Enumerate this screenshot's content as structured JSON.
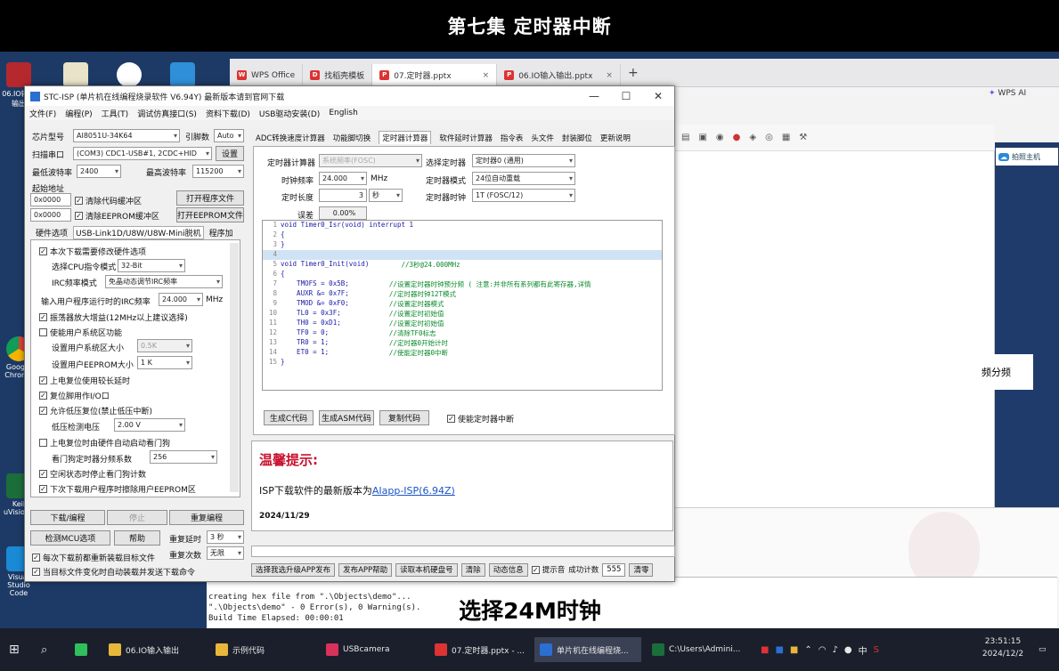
{
  "video_title": "第七集 定时器中断",
  "subtitle": "选择24M时钟",
  "desktop_icons": [
    {
      "label": "06.IO输入输出"
    },
    {
      "label": ""
    },
    {
      "label": ""
    },
    {
      "label": ""
    },
    {
      "label": "Google Chrome"
    },
    {
      "label": "Keil uVision5"
    },
    {
      "label": "Visual Studio Code"
    }
  ],
  "wps": {
    "tabs": [
      {
        "label": "WPS Office",
        "color": "#d33"
      },
      {
        "label": "找稻壳模板",
        "color": "#d33"
      },
      {
        "label": "07.定时器.pptx",
        "color": "#d33"
      },
      {
        "label": "06.IO输入输出.pptx",
        "color": "#d33"
      }
    ],
    "wps_ai": "WPS AI",
    "side_label": "拍照主机",
    "right_text": "频分频",
    "build_output": [
      "creating hex file from \".\\Objects\\demo\"...",
      "\".\\Objects\\demo\" - 0 Error(s), 0 Warning(s).",
      "Build Time Elapsed:  00:00:01"
    ]
  },
  "isp": {
    "title": "STC-ISP (单片机在线编程烧录软件 V6.94Y) 最新版本请到官网下载",
    "menu": [
      "文件(F)",
      "编程(P)",
      "工具(T)",
      "调试仿真接口(S)",
      "资料下载(D)",
      "USB驱动安装(D)",
      "English"
    ],
    "chip_label": "芯片型号",
    "chip_value": "AI8051U-34K64",
    "pin_label": "引脚数",
    "pin_value": "Auto",
    "port_label": "扫描串口",
    "port_value": "(COM3) CDC1-USB#1, 2CDC+HID",
    "settings_btn": "设置",
    "min_baud_label": "最低波特率",
    "min_baud_value": "2400",
    "max_baud_label": "最高波特率",
    "max_baud_value": "115200",
    "start_addr_label": "起始地址",
    "addr1": "0x0000",
    "clear_code": "清除代码缓冲区",
    "open_prog": "打开程序文件",
    "addr2": "0x0000",
    "clear_eeprom": "清除EEPROM缓冲区",
    "open_eeprom": "打开EEPROM文件",
    "hw_label": "硬件选项",
    "hw_value": "USB-Link1D/U8W/U8W-Mini脱机",
    "hw_tab2": "程序加",
    "options": [
      {
        "label": "本次下载需要修改硬件选项",
        "checked": true
      },
      {
        "label": "选择CPU指令模式",
        "value": "32-Bit",
        "type": "combo"
      },
      {
        "label": "IRC频率模式",
        "value": "免晶动态调节IRC频率",
        "type": "combo"
      },
      {
        "label": "输入用户程序运行时的IRC频率",
        "value": "24.000",
        "unit": "MHz",
        "type": "combo"
      },
      {
        "label": "振荡器放大增益(12MHz以上建议选择)",
        "checked": true
      },
      {
        "label": "使能用户系统区功能",
        "checked": false
      },
      {
        "label": "设置用户系统区大小",
        "value": "0.5K",
        "type": "combo"
      },
      {
        "label": "设置用户EEPROM大小",
        "value": "1 K",
        "type": "combo"
      },
      {
        "label": "上电复位使用较长延时",
        "checked": true
      },
      {
        "label": "复位脚用作I/O口",
        "checked": true
      },
      {
        "label": "允许低压复位(禁止低压中断)",
        "checked": true
      },
      {
        "label": "低压检测电压",
        "value": "2.00 V",
        "type": "combo"
      },
      {
        "label": "上电复位时由硬件自动启动看门狗",
        "checked": false
      },
      {
        "label": "看门狗定时器分频系数",
        "value": "256",
        "type": "combo"
      },
      {
        "label": "空闲状态时停止看门狗计数",
        "checked": true
      },
      {
        "label": "下次下载用户程序时擦除用户EEPROM区",
        "checked": true
      }
    ],
    "btn_download": "下载/编程",
    "btn_stop": "停止",
    "btn_reprogram": "重复编程",
    "btn_check": "检测MCU选项",
    "btn_help": "帮助",
    "repeat_delay_label": "重复延时",
    "repeat_delay_value": "3 秒",
    "repeat_count_label": "重复次数",
    "repeat_count_value": "无限",
    "chk_reload": "每次下载前都重新装载目标文件",
    "chk_auto": "当目标文件变化时自动装载并发送下载命令",
    "tabs": [
      "ADC转换速度计算器",
      "功能脚切换",
      "定时器计算器",
      "软件延时计算器",
      "指令表",
      "头文件",
      "封装脚位",
      "更新说明"
    ],
    "active_tab": 2,
    "timer": {
      "tool_label": "定时器计算器",
      "tool_value": "系统频率(FOSC)",
      "freq_label": "时钟频率",
      "freq_value": "24.000",
      "freq_unit": "MHz",
      "len_label": "定时长度",
      "len_value": "3",
      "len_unit": "秒",
      "err_label": "误差",
      "err_value": "0.00%",
      "sel_timer_label": "选择定时器",
      "sel_timer_value": "定时器0 (通用)",
      "mode_label": "定时器模式",
      "mode_value": "24位自动重载",
      "clk_label": "定时器时钟",
      "clk_value": "1T (FOSC/12)"
    },
    "code": [
      {
        "n": "1",
        "t": "void Timer0_Isr(void) interrupt 1",
        "c": ""
      },
      {
        "n": "2",
        "t": "{",
        "c": ""
      },
      {
        "n": "3",
        "t": "}",
        "c": ""
      },
      {
        "n": "4",
        "t": "",
        "c": ""
      },
      {
        "n": "5",
        "t": "void Timer0_Init(void)",
        "c": "        //3秒@24.000MHz"
      },
      {
        "n": "6",
        "t": "{",
        "c": ""
      },
      {
        "n": "7",
        "t": "    TMOFS = 0x5B;",
        "c": "          //设置定时器时钟预分频 ( 注意:并非所有系列都有此寄存器,详情"
      },
      {
        "n": "8",
        "t": "    AUXR &= 0x7F;",
        "c": "          //定时器时钟12T模式"
      },
      {
        "n": "9",
        "t": "    TMOD &= 0xF0;",
        "c": "          //设置定时器模式"
      },
      {
        "n": "10",
        "t": "    TL0 = 0x3F;",
        "c": "            //设置定时初始值"
      },
      {
        "n": "11",
        "t": "    TH0 = 0xD1;",
        "c": "            //设置定时初始值"
      },
      {
        "n": "12",
        "t": "    TF0 = 0;",
        "c": "               //清除TF0标志"
      },
      {
        "n": "13",
        "t": "    TR0 = 1;",
        "c": "               //定时器0开始计时"
      },
      {
        "n": "14",
        "t": "    ET0 = 1;",
        "c": "               //使能定时器0中断"
      },
      {
        "n": "15",
        "t": "}",
        "c": ""
      }
    ],
    "gen_code": "生成C代码",
    "gen_asm": "生成ASM代码",
    "copy_code": "复制代码",
    "enable_int": "使能定时器中断",
    "tip_title": "温馨提示:",
    "tip_text": "ISP下载软件的最新版本为",
    "tip_link": "AIapp-ISP(6.94Z)",
    "tip_date": "2024/11/29",
    "status": [
      "选择我选升级APP发布",
      "发布APP帮助",
      "读取本机硬盘号",
      "清除",
      "动态信息",
      "提示音",
      "成功计数",
      "555",
      "清零"
    ]
  },
  "taskbar": {
    "items": [
      "06.IO输入输出",
      "示例代码",
      "USBcamera",
      "07.定时器.pptx - ...",
      "单片机在线编程烧...",
      "C:\\Users\\Admini..."
    ],
    "ime": "中",
    "time": "23:51:15",
    "date": "2024/12/2"
  }
}
